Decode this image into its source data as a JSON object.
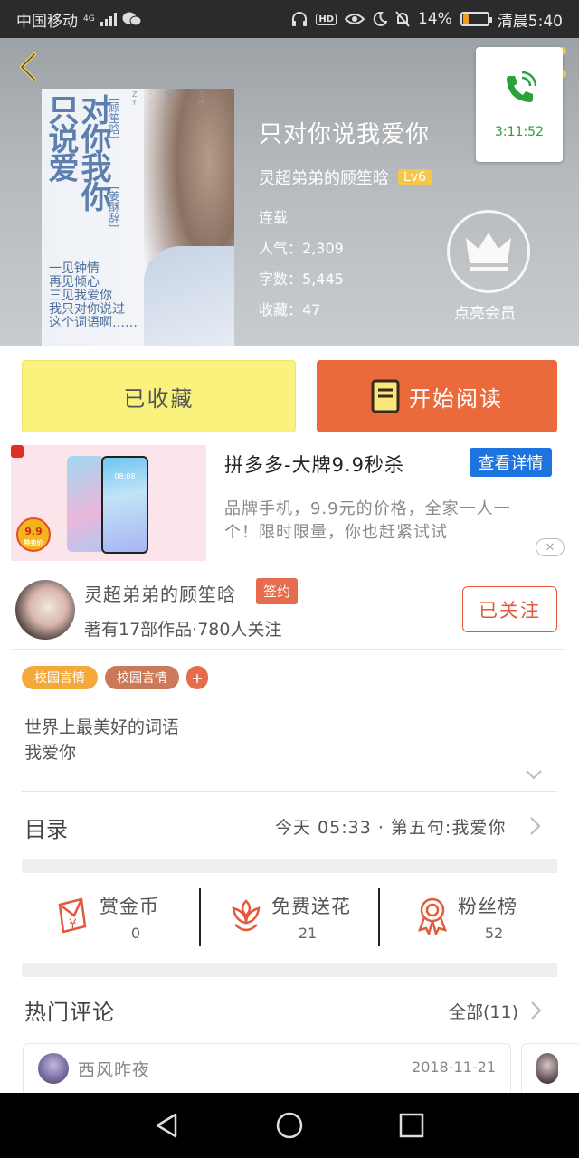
{
  "status_bar": {
    "carrier": "中国移动",
    "network": "4G",
    "battery": "14%",
    "time": "清晨5:40"
  },
  "book": {
    "title": "只对你说我爱你",
    "author": "灵超弟弟的顾笙晗",
    "level": "Lv6",
    "status": "连载",
    "popularity": "人气：2,309",
    "word_count": "字数：5,445",
    "favorites": "收藏：47",
    "vip_label": "点亮会员",
    "cover": {
      "title_a": "只说爱",
      "title_b": "对你我你",
      "author_a": "[顾笙晗]",
      "author_b": "[姜酥辞]",
      "letters": "Z · N · S · Y · A · N",
      "tagline": "一见钟情\n再见倾心\n三见我爱你\n我只对你说过\n这个词语啊……"
    }
  },
  "call_widget": {
    "duration": "3:11:52"
  },
  "buttons": {
    "favorited": "已收藏",
    "start_reading": "开始阅读"
  },
  "ad": {
    "title": "拼多多-大牌9.9秒杀",
    "detail_button": "查看详情",
    "description": "品牌手机，9.9元的价格，全家一人一个！限时限量，你也赶紧试试",
    "badge_price": "9.9",
    "badge_sub": "特卖价",
    "phone_time": "08:08",
    "close": "✕"
  },
  "author_section": {
    "name": "灵超弟弟的顾笙晗",
    "signed": "签约",
    "meta": "著有17部作品·780人关注",
    "follow_button": "已关注"
  },
  "tags": [
    "校园言情",
    "校园言情",
    "+"
  ],
  "description_lines": [
    "世界上最美好的词语",
    "我爱你"
  ],
  "toc": {
    "label": "目录",
    "latest": "今天 05:33 · 第五句:我爱你"
  },
  "actions": [
    {
      "label": "赏金币",
      "count": "0",
      "icon": "red-envelope-coin-icon"
    },
    {
      "label": "免费送花",
      "count": "21",
      "icon": "flower-icon"
    },
    {
      "label": "粉丝榜",
      "count": "52",
      "icon": "medal-ribbon-icon"
    }
  ],
  "comments": {
    "label": "热门评论",
    "all": "全部(11)",
    "items": [
      {
        "user": "西风昨夜",
        "date": "2018-11-21"
      }
    ]
  },
  "colors": {
    "accent_orange": "#eb6a3c",
    "favorite_yellow": "#fbf27d",
    "ad_blue": "#1d74de",
    "icon_red": "#e4593a",
    "call_green": "#2aa13a"
  }
}
